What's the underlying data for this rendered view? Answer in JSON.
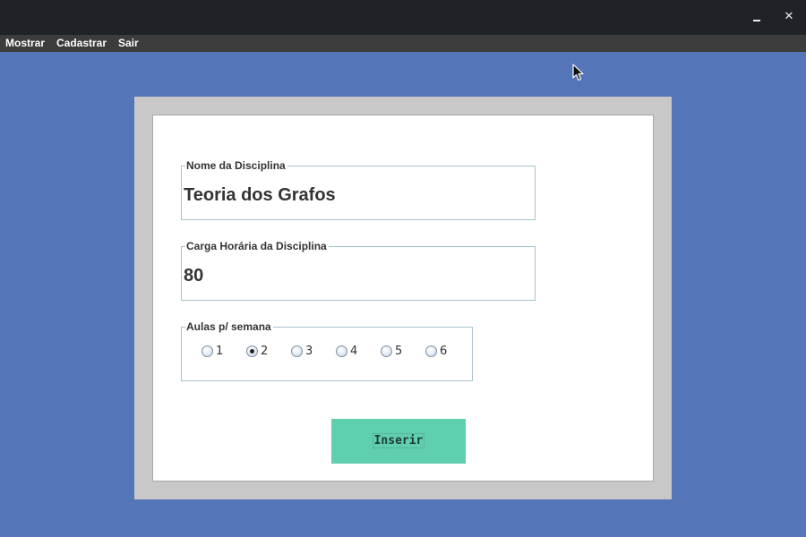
{
  "window": {
    "minimize_glyph": "",
    "close_glyph": "✕"
  },
  "menu": {
    "items": [
      {
        "label": "Mostrar"
      },
      {
        "label": "Cadastrar"
      },
      {
        "label": "Sair"
      }
    ]
  },
  "form": {
    "name_field": {
      "legend": "Nome da Disciplina",
      "value": "Teoria dos Grafos"
    },
    "hours_field": {
      "legend": "Carga Horária da Disciplina",
      "value": "80"
    },
    "classes_per_week": {
      "legend": "Aulas p/ semana",
      "options": [
        "1",
        "2",
        "3",
        "4",
        "5",
        "6"
      ],
      "selected": "2"
    },
    "submit_label": "Inserir"
  },
  "icons": {
    "minimize": "minimize-icon",
    "close": "close-icon",
    "cursor": "mouse-cursor-icon"
  },
  "colors": {
    "desktop_bg": "#5475b8",
    "titlebar": "#1f2327",
    "menubar": "#3c3c3c",
    "button": "#5fcfb0"
  }
}
